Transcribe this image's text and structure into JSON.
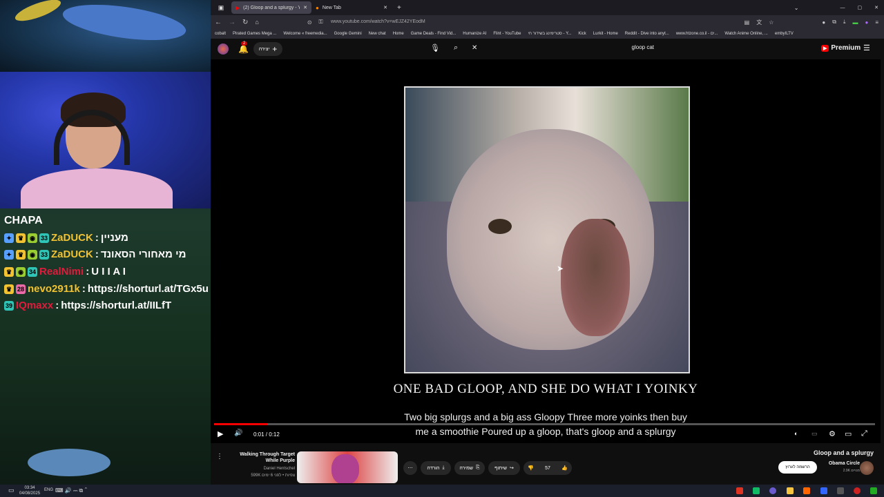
{
  "overlay": {
    "channel": "CHAPA",
    "chat": [
      {
        "badges": [
          "33"
        ],
        "user": "ZaDUCK",
        "user_color": "#f1c232",
        "message": "מעניין"
      },
      {
        "badges": [
          "33"
        ],
        "user": "ZaDUCK",
        "user_color": "#f1c232",
        "message": "מי מאחורי הסאונד"
      },
      {
        "badges": [
          "34"
        ],
        "user": "RealNimi",
        "user_color": "#e01b3c",
        "message": "U I I A I"
      },
      {
        "badges": [
          "28"
        ],
        "user": "nevo2911k",
        "user_color": "#f1c232",
        "message": "https://shorturl.at/TGx5u"
      },
      {
        "badges": [
          "39"
        ],
        "user": "IQmaxx",
        "user_color": "#e01b3c",
        "message": "https://shorturl.at/IILfT"
      }
    ]
  },
  "browser": {
    "tabs": [
      {
        "title": "(2) Gloop and a splurgy - YouTube",
        "active": true
      },
      {
        "title": "New Tab",
        "active": false
      }
    ],
    "url": "www.youtube.com/watch?v=wEJZ42YEodM",
    "bookmarks": [
      "cobalt",
      "Pirated Games Mega ...",
      "Welcome « freemedia...",
      "Google Gemini",
      "New chat",
      "Home",
      "Game Deals - Find Vid...",
      "Humanize AI",
      "Flint - YouTube",
      "סטרימינג בשידור חי - Y...",
      "Kick",
      "Lurkit - Home",
      "Reddit - Dive into anyt...",
      "www.htzone.co.il - ים...",
      "Watch Anime Online, ...",
      "embyILTV"
    ]
  },
  "youtube": {
    "create_label": "יצירה",
    "notifications_count": "2",
    "search_value": "gloop cat",
    "premium_label": "Premium",
    "player": {
      "caption_top": "ONE BAD GLOOP, AND SHE DO WHAT I YOINKY",
      "subtitle_line1": "Two big splurgs and a big ass Gloopy Three more yoinks then buy",
      "subtitle_line2": "me a smoothie Poured up a gloop,  that's gloop and a splurgy",
      "time_display": "0:01 / 0:12",
      "progress": 0.08
    },
    "video_title": "Gloop and a splurgy",
    "channel_name": "Obama Circle",
    "subscribers": "2.9K מנויים",
    "subscribe_label": "הרשמה לערוץ",
    "like_count": "57",
    "share_label": "שיתוף",
    "save_label": "שמירה",
    "download_label": "הורדה",
    "related": {
      "title": "Walking Through Target While Purple",
      "channel": "Daniel Hentschel",
      "meta": "599K צפיות • לפני 6 ימים",
      "views_badge": "599K"
    }
  },
  "taskbar": {
    "time": "03:34",
    "date": "04/08/2025",
    "lang": "ENG"
  }
}
